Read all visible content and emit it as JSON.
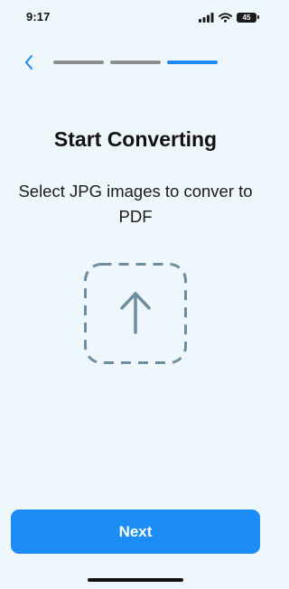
{
  "status_bar": {
    "time": "9:17",
    "battery_level": "45",
    "icons": [
      "signal-icon",
      "wifi-icon",
      "battery-icon"
    ]
  },
  "nav": {
    "back_icon": "chevron-left-icon",
    "progress": {
      "total_steps": 3,
      "current_step": 3
    }
  },
  "main": {
    "title": "Start Converting",
    "subtitle": "Select JPG images to conver to PDF",
    "upload_icon": "arrow-up-icon"
  },
  "footer": {
    "next_label": "Next"
  },
  "colors": {
    "background": "#eef8fc",
    "accent": "#1c8cf7",
    "inactive_step": "#8c8c8c",
    "upload_stroke": "#6e8ea0"
  }
}
